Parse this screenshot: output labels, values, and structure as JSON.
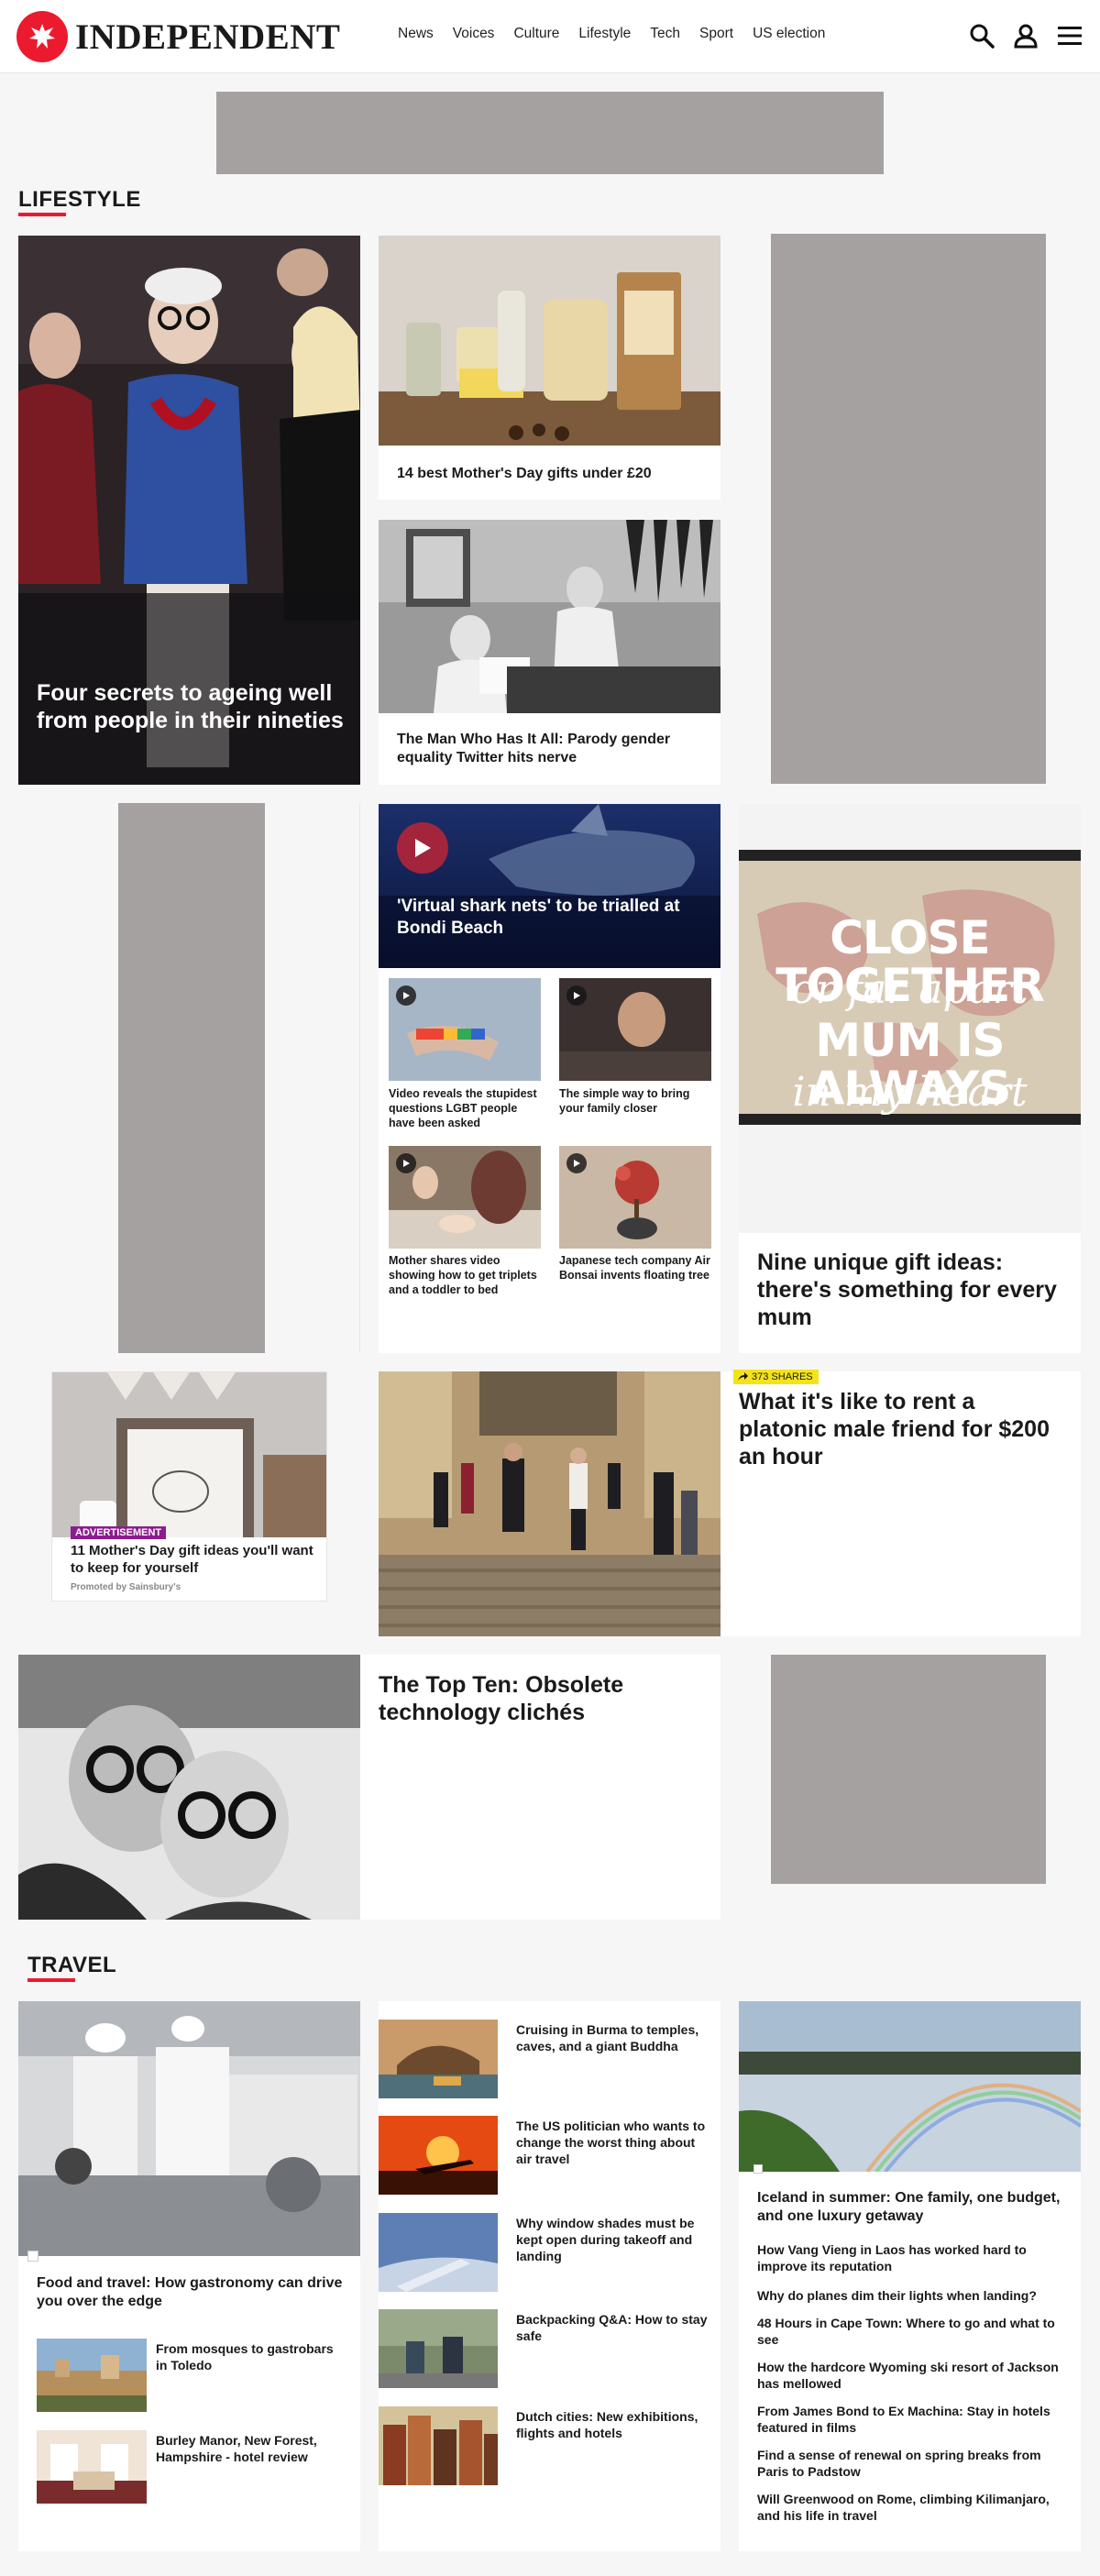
{
  "header": {
    "logo_text": "INDEPENDENT",
    "nav": [
      "News",
      "Voices",
      "Culture",
      "Lifestyle",
      "Tech",
      "Sport",
      "US election"
    ],
    "icons": [
      "search-icon",
      "account-icon",
      "menu-icon"
    ]
  },
  "colors": {
    "brand_red": "#ec1a2e",
    "ad_gray": "#a6a1a1",
    "badge_yellow": "#f5e31a",
    "advert_purple": "#8c1d8e",
    "play_red": "#a3253c"
  },
  "lifestyle": {
    "section_title": "LIFESTYLE",
    "feature_title": "Four secrets to ageing well from people in their nineties",
    "card1_title": "14 best Mother's Day gifts under £20",
    "card2_title": "The Man Who Has It All: Parody gender equality Twitter hits nerve",
    "video_main_title": "'Virtual shark nets' to be trialled at Bondi Beach",
    "videos": [
      "Video reveals the stupidest questions LGBT people have been asked",
      "The simple way to bring your family closer",
      "Mother shares video showing how to get triplets and a toddler to bed",
      "Japanese tech company Air Bonsai invents floating tree"
    ],
    "gift_image_text": [
      "CLOSE TOGETHER",
      "or far apart",
      "MUM IS ALWAYS",
      "in my heart"
    ],
    "gift_title": "Nine unique gift ideas: there's something for every mum",
    "ad_badge": "ADVERTISEMENT",
    "ad_title": "11 Mother's Day gift ideas you'll want to keep for yourself",
    "ad_promoted": "Promoted by Sainsbury's",
    "shares_badge": "373 SHARES",
    "platonic_title": "What it's like to rent a platonic male friend for $200 an hour",
    "topten_title": "The Top Ten: Obsolete technology clichés"
  },
  "travel": {
    "section_title": "TRAVEL",
    "feature_title": "Food and travel: How gastronomy can drive you over the edge",
    "left_list": [
      "From mosques to gastrobars in Toledo",
      "Burley Manor, New Forest, Hampshire - hotel review"
    ],
    "middle_list": [
      "Cruising in Burma to temples, caves, and a giant Buddha",
      "The US politician who wants to change the worst thing about air travel",
      "Why window shades must be kept open during takeoff and landing",
      "Backpacking Q&A: How to stay safe",
      "Dutch cities: New exhibitions, flights and hotels"
    ],
    "iceland_title": "Iceland in summer: One family, one budget, and one luxury getaway",
    "right_list": [
      "How Vang Vieng in Laos has worked hard to improve its reputation",
      "Why do planes dim their lights when landing?",
      "48 Hours in Cape Town: Where to go and what to see",
      "How the hardcore Wyoming ski resort of Jackson has mellowed",
      "From James Bond to Ex Machina: Stay in hotels featured in films",
      "Find a sense of renewal on spring breaks from Paris to Padstow",
      "Will Greenwood on Rome, climbing Kilimanjaro, and his life in travel"
    ]
  }
}
